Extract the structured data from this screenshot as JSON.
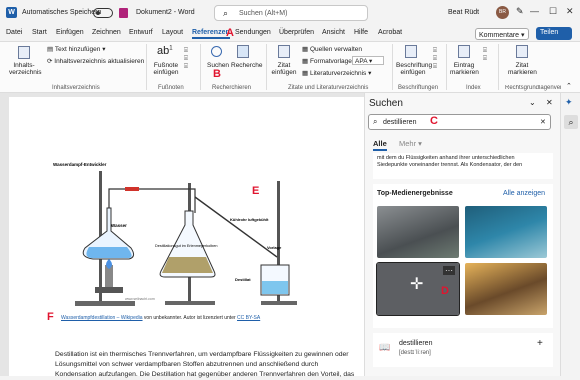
{
  "titlebar": {
    "autosave": "Automatisches Speichern",
    "doc_title": "Dokument2 - Word",
    "search_placeholder": "Suchen (Alt+M)",
    "user_name": "Beat Rüdt",
    "user_initials": "BR"
  },
  "tabs": [
    "Datei",
    "Start",
    "Einfügen",
    "Zeichnen",
    "Entwurf",
    "Layout",
    "Referenzen",
    "Sendungen",
    "Überprüfen",
    "Ansicht",
    "Hilfe",
    "Acrobat"
  ],
  "kommentare": "Kommentare",
  "teilen": "Teilen",
  "ribbon": {
    "toc": "Inhalts-verzeichnis",
    "add_text": "Text hinzufügen",
    "update_toc": "Inhaltsverzeichnis aktualisieren",
    "grp_toc": "Inhaltsverzeichnis",
    "footnote": "Fußnote einfügen",
    "grp_footnotes": "Fußnoten",
    "suchen": "Suchen",
    "recherche": "Recherche",
    "grp_research": "Recherchieren",
    "zitat": "Zitat einfügen",
    "quellen": "Quellen verwalten",
    "formatvorlage": "Formatvorlage:",
    "apa": "APA",
    "litverz": "Literaturverzeichnis",
    "grp_citations": "Zitate und Literaturverzeichnis",
    "beschriftung": "Beschriftung einfügen",
    "grp_captions": "Beschriftungen",
    "eintrag": "Eintrag markieren",
    "grp_index": "Index",
    "zitat_mark": "Zitat markieren",
    "grp_rechts": "Rechtsgrundlagenver..."
  },
  "markers": {
    "a": "A",
    "b": "B",
    "c": "C",
    "d": "D",
    "e": "E",
    "f": "F"
  },
  "diagram": {
    "l1": "Wasserdampf-Entwickler",
    "l2": "Wasser",
    "l3": "Destillationsgut im Erlenmeyerkolben",
    "l4": "Kühlrohr luftgekühlt",
    "l5": "Vorlage",
    "l6": "Destillat",
    "credit": "www.seilnacht.com"
  },
  "caption": {
    "link": "Wasserdampfdestillation – Wikipedia",
    "mid": " von unbekannter. Autor ist lizenziert unter ",
    "license": "CC BY-SA"
  },
  "body_text": [
    "Destillation ist ein thermisches Trennverfahren, um verdampfbare Flüssigkeiten zu gewinnen oder",
    "Lösungsmittel von schwer verdampfbaren Stoffen abzutrennen und anschließend durch",
    "Kondensation aufzufangen. Die Destillation hat gegenüber anderen Trennverfahren den Vorteil, das"
  ],
  "pane": {
    "title": "Suchen",
    "query": "destillieren",
    "filter_all": "Alle",
    "filter_more": "Mehr",
    "snippet": [
      "mit dem du Flüssigkeiten anhand ihrer unterschiedlichen",
      "Siedepunkte voneinander trennst. Als Kondensator, der den"
    ],
    "media_title": "Top-Medienergebnisse",
    "show_all": "Alle anzeigen",
    "word": "destillieren",
    "phonetic": "[destɪˈliːrən]"
  },
  "colors": {
    "accent": "#1f5fa9",
    "marker": "#e0152f"
  }
}
